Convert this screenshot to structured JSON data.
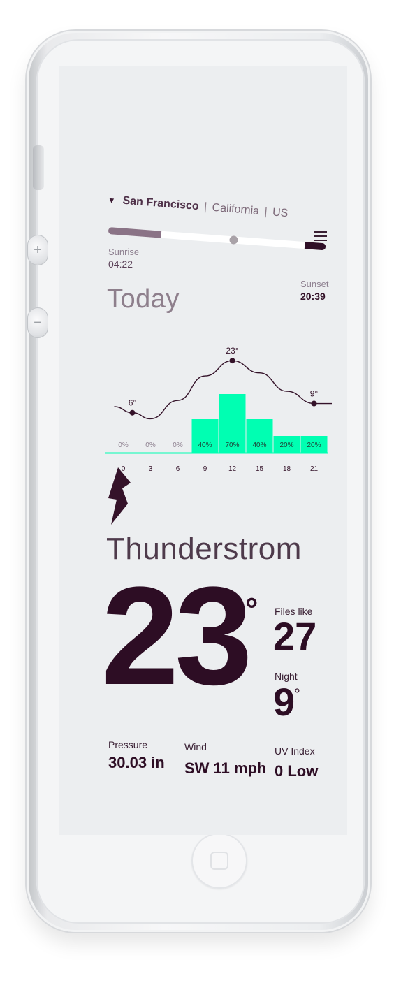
{
  "header": {
    "city": "San Francisco",
    "region": "California",
    "country": "US",
    "separator": "|",
    "location_triangle": "▼",
    "menu_icon": "hamburger-menu-icon"
  },
  "daylight": {
    "sunrise_label": "Sunrise",
    "sunrise_time": "04:22",
    "sunset_label": "Sunset",
    "sunset_time": "20:39",
    "colors": {
      "elapsed": "#8a7386",
      "remaining": "#ffffff",
      "end": "#2f0f27"
    }
  },
  "title": "Today",
  "chart_data": {
    "type": "bar",
    "categories": [
      "0",
      "3",
      "6",
      "9",
      "12",
      "15",
      "18",
      "21"
    ],
    "series": [
      {
        "values": [
          0,
          0,
          0,
          40,
          70,
          40,
          20,
          20
        ]
      }
    ],
    "bar_labels": [
      "0%",
      "0%",
      "0%",
      "40%",
      "70%",
      "40%",
      "20%",
      "20%"
    ],
    "temperature_line": {
      "type": "line",
      "x": [
        0,
        3,
        6,
        9,
        12,
        15,
        18,
        21
      ],
      "values": [
        6,
        4,
        10,
        18,
        23,
        19,
        13,
        9
      ],
      "annotated_points": [
        {
          "x": 1,
          "label": "6°"
        },
        {
          "x": 12,
          "label": "23°"
        },
        {
          "x": 21,
          "label": "9°"
        }
      ]
    },
    "bar_color": "#00ffb2",
    "line_color": "#341229"
  },
  "weather": {
    "icon": "lightning-bolt-icon",
    "condition": "Thunderstrom",
    "temperature": "23",
    "degree": "°",
    "feels_label": "Files like",
    "feels_value": "27",
    "night_label": "Night",
    "night_value": "9"
  },
  "stats": [
    {
      "label": "Pressure",
      "value": "30.03 in"
    },
    {
      "label": "Wind",
      "value": "SW 11 mph"
    },
    {
      "label": "UV Index",
      "value": "0 Low"
    }
  ]
}
